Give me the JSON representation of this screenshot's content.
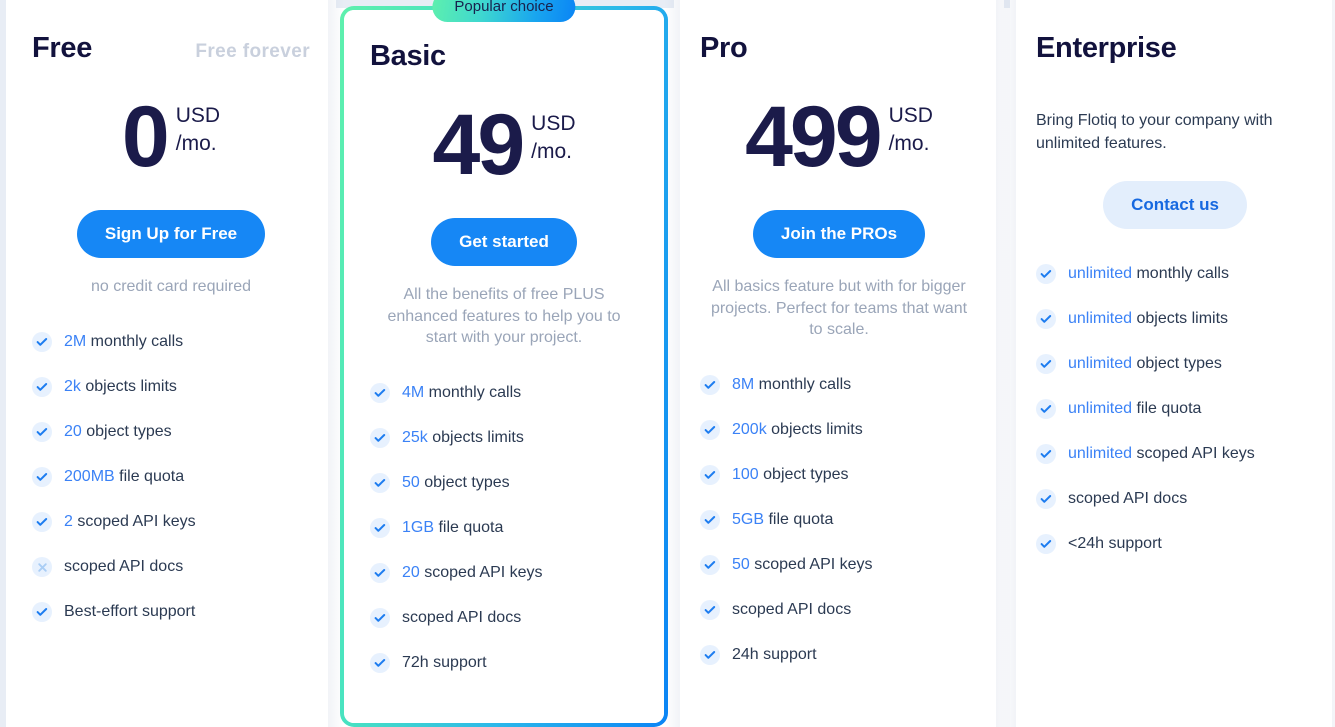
{
  "theme": {
    "accent_blue": "#1687f5",
    "dark_navy": "#1b1b4a",
    "muted_gray": "#9aa5b8",
    "mint": "#5ef0ad",
    "check_bg": "#e7f1fe",
    "page_edge": "#e8edf5"
  },
  "badge": {
    "label": "Popular choice"
  },
  "plans": [
    {
      "name": "Free",
      "tagline": "Free forever",
      "price": "0",
      "currency": "USD",
      "period": "/mo.",
      "cta": "Sign Up for Free",
      "cta_style": "primary",
      "note": "no credit card required",
      "description": "",
      "featured": false,
      "features": [
        {
          "highlight": "2M",
          "rest": " monthly calls",
          "included": true,
          "icon": "check-icon"
        },
        {
          "highlight": "2k",
          "rest": " objects limits",
          "included": true,
          "icon": "check-icon"
        },
        {
          "highlight": "20",
          "rest": " object types",
          "included": true,
          "icon": "check-icon"
        },
        {
          "highlight": "200MB",
          "rest": " file quota",
          "included": true,
          "icon": "check-icon"
        },
        {
          "highlight": "2",
          "rest": " scoped API keys",
          "included": true,
          "icon": "check-icon"
        },
        {
          "highlight": "",
          "rest": "scoped API docs",
          "included": false,
          "icon": "close-icon"
        },
        {
          "highlight": "",
          "rest": "Best-effort support",
          "included": true,
          "icon": "check-icon"
        }
      ]
    },
    {
      "name": "Basic",
      "tagline": "",
      "price": "49",
      "currency": "USD",
      "period": "/mo.",
      "cta": "Get started",
      "cta_style": "primary",
      "note": "All the benefits of free PLUS enhanced features to help you to start with your project.",
      "description": "",
      "featured": true,
      "features": [
        {
          "highlight": "4M",
          "rest": " monthly calls",
          "included": true,
          "icon": "check-icon"
        },
        {
          "highlight": "25k",
          "rest": " objects limits",
          "included": true,
          "icon": "check-icon"
        },
        {
          "highlight": "50",
          "rest": " object types",
          "included": true,
          "icon": "check-icon"
        },
        {
          "highlight": "1GB",
          "rest": " file quota",
          "included": true,
          "icon": "check-icon"
        },
        {
          "highlight": "20",
          "rest": " scoped API keys",
          "included": true,
          "icon": "check-icon"
        },
        {
          "highlight": "",
          "rest": "scoped API docs",
          "included": true,
          "icon": "check-icon"
        },
        {
          "highlight": "",
          "rest": "72h support",
          "included": true,
          "icon": "check-icon"
        }
      ]
    },
    {
      "name": "Pro",
      "tagline": "",
      "price": "499",
      "currency": "USD",
      "period": "/mo.",
      "cta": "Join the PROs",
      "cta_style": "primary",
      "note": "All basics feature but with for bigger projects. Perfect for teams that want to scale.",
      "description": "",
      "featured": false,
      "features": [
        {
          "highlight": "8M",
          "rest": " monthly calls",
          "included": true,
          "icon": "check-icon"
        },
        {
          "highlight": "200k",
          "rest": " objects limits",
          "included": true,
          "icon": "check-icon"
        },
        {
          "highlight": "100",
          "rest": " object types",
          "included": true,
          "icon": "check-icon"
        },
        {
          "highlight": "5GB",
          "rest": " file quota",
          "included": true,
          "icon": "check-icon"
        },
        {
          "highlight": "50",
          "rest": " scoped API keys",
          "included": true,
          "icon": "check-icon"
        },
        {
          "highlight": "",
          "rest": "scoped API docs",
          "included": true,
          "icon": "check-icon"
        },
        {
          "highlight": "",
          "rest": "24h support",
          "included": true,
          "icon": "check-icon"
        }
      ]
    },
    {
      "name": "Enterprise",
      "tagline": "",
      "price": "",
      "currency": "",
      "period": "",
      "cta": "Contact us",
      "cta_style": "soft",
      "note": "",
      "description": "Bring Flotiq to your company with unlimited features.",
      "featured": false,
      "features": [
        {
          "highlight": "unlimited",
          "rest": " monthly calls",
          "included": true,
          "icon": "check-icon"
        },
        {
          "highlight": "unlimited",
          "rest": " objects limits",
          "included": true,
          "icon": "check-icon"
        },
        {
          "highlight": "unlimited",
          "rest": " object types",
          "included": true,
          "icon": "check-icon"
        },
        {
          "highlight": "unlimited",
          "rest": " file quota",
          "included": true,
          "icon": "check-icon"
        },
        {
          "highlight": "unlimited",
          "rest": " scoped API keys",
          "included": true,
          "icon": "check-icon"
        },
        {
          "highlight": "",
          "rest": "scoped API docs",
          "included": true,
          "icon": "check-icon"
        },
        {
          "highlight": "",
          "rest": "<24h support",
          "included": true,
          "icon": "check-icon"
        }
      ]
    }
  ]
}
